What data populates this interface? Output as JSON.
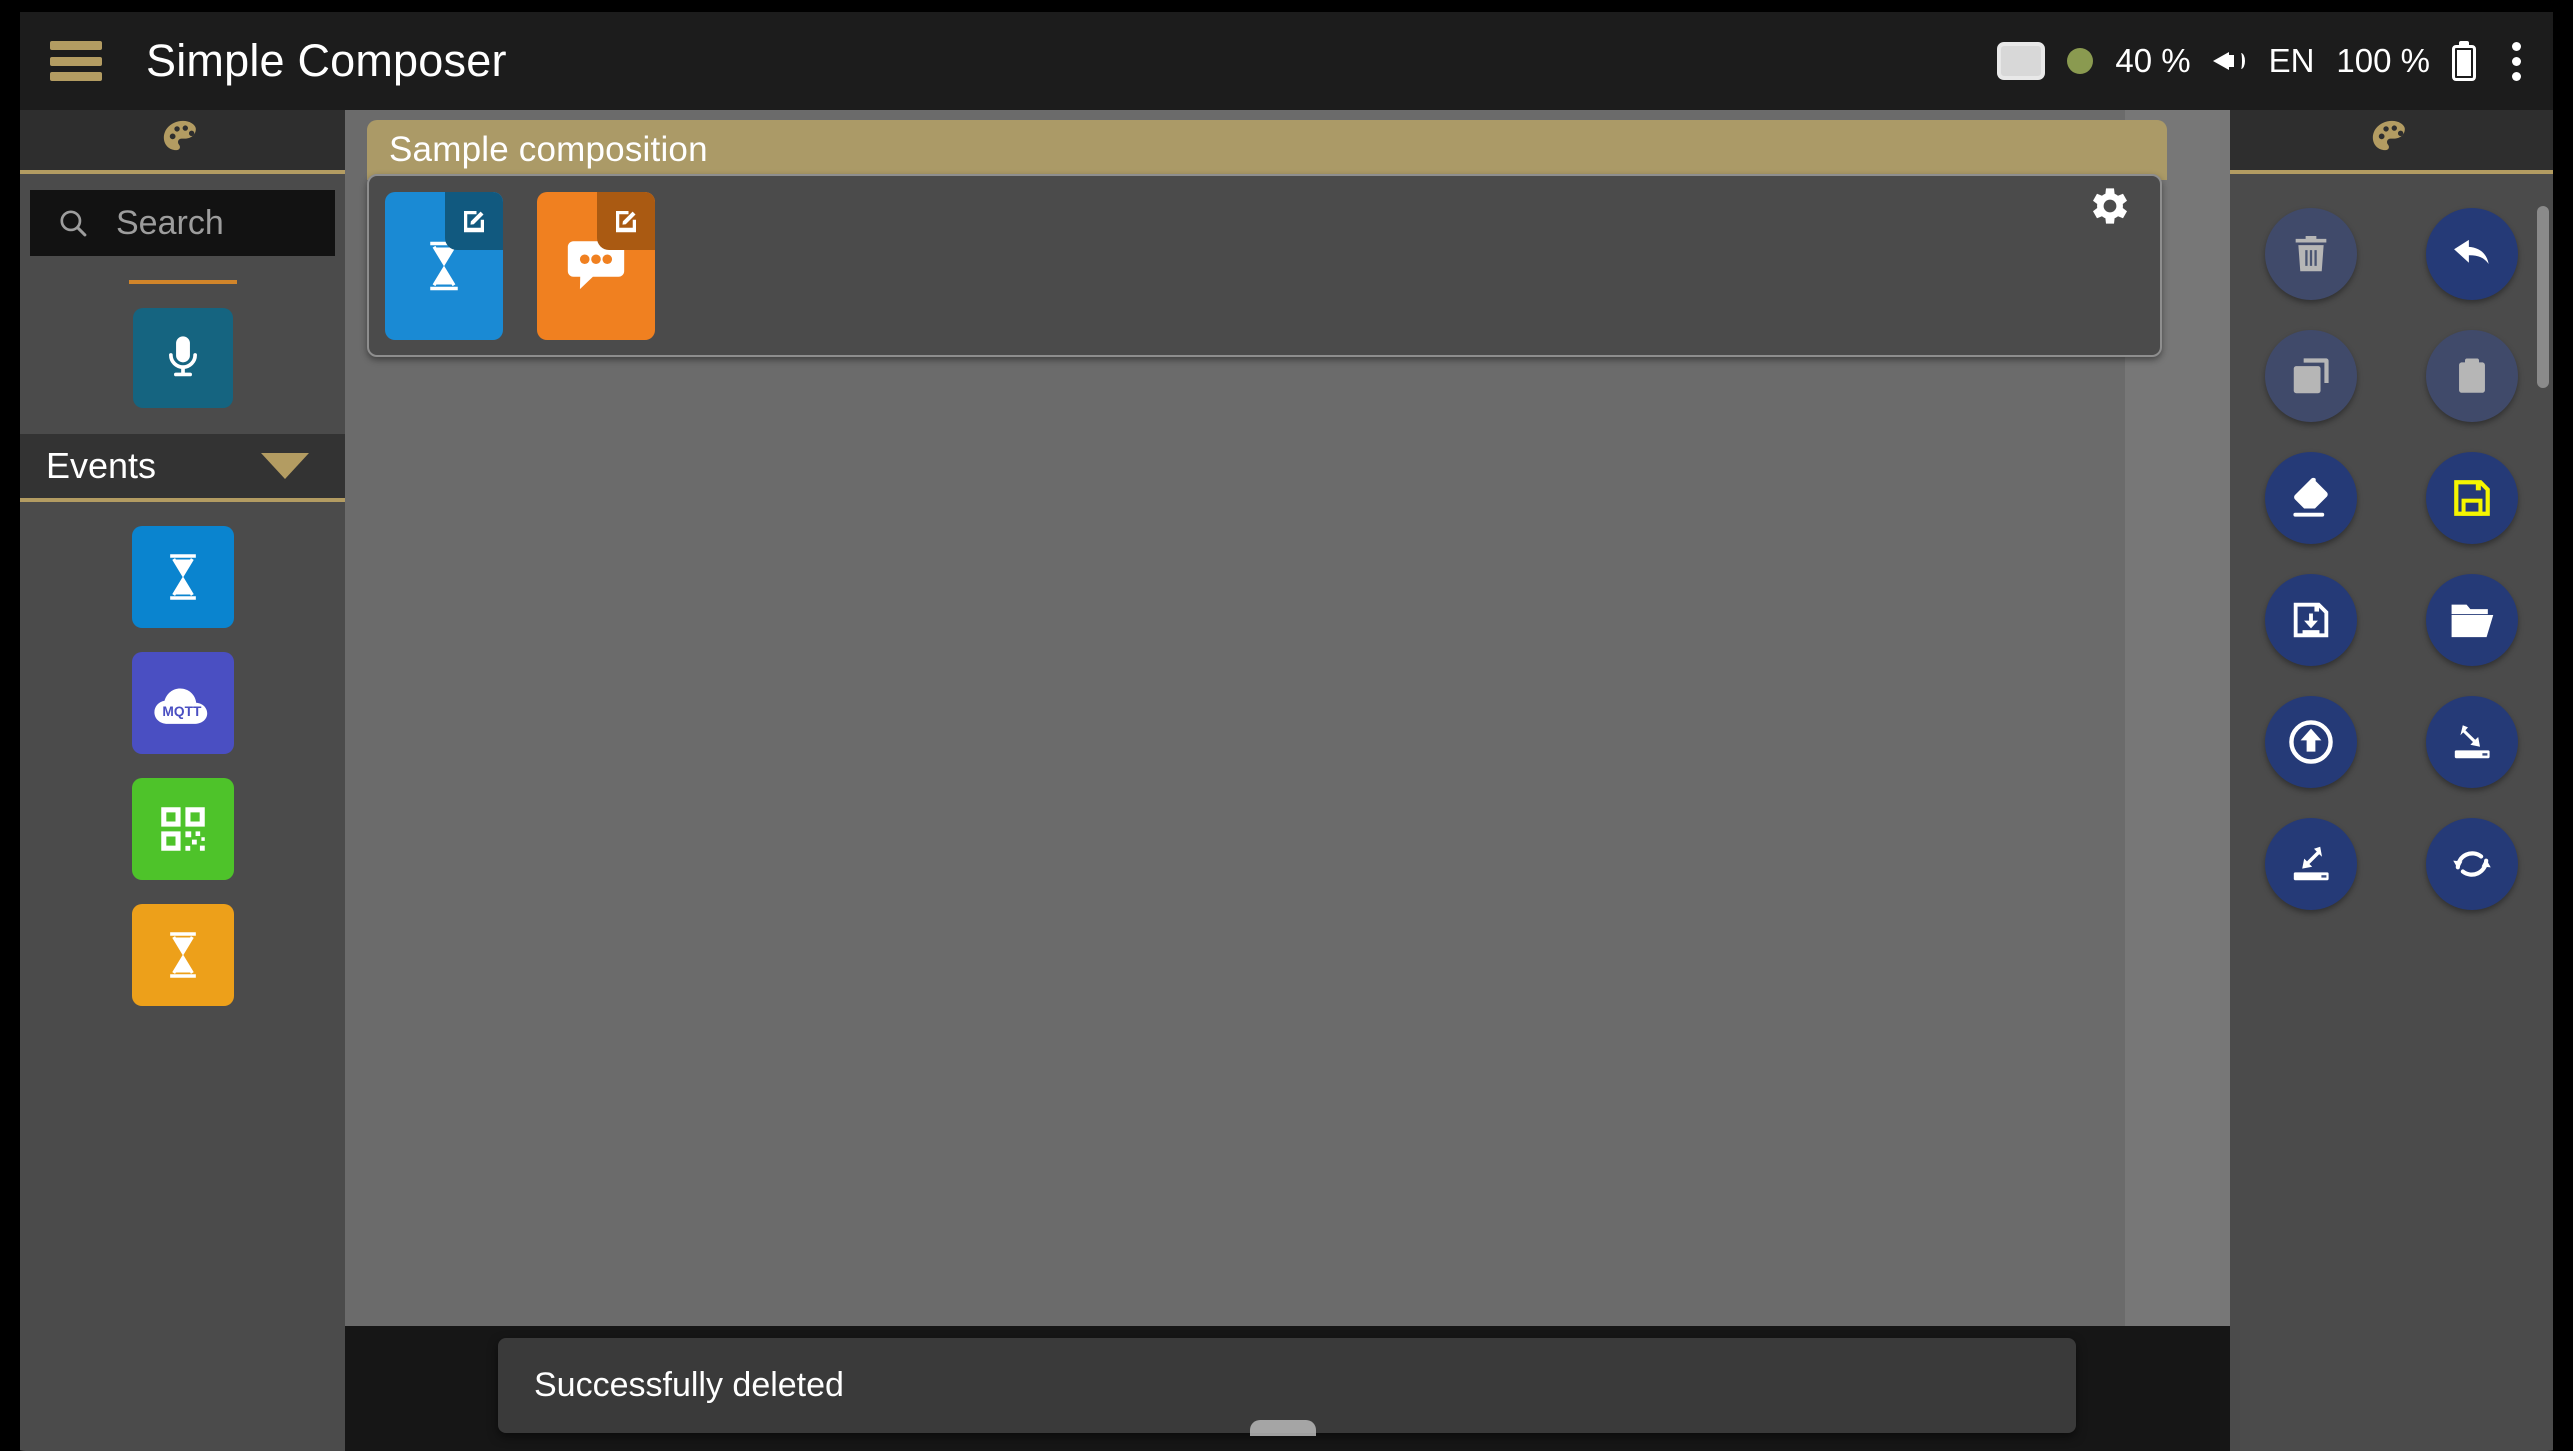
{
  "app": {
    "title": "Simple Composer",
    "menu_icon": "hamburger-icon",
    "overflow_icon": "three-dot-menu-icon"
  },
  "statusbar": {
    "screen_icon": "screen-icon",
    "recording_dot": "green-status-dot",
    "brightness": "40 %",
    "volume_icon": "speaker-icon",
    "language": "EN",
    "battery_level": "100 %",
    "battery_icon": "battery-icon"
  },
  "left_panel": {
    "header_icon": "palette-icon",
    "search": {
      "icon": "search-icon",
      "value": "",
      "placeholder": "Search"
    },
    "featured": {
      "name": "microphone-tile",
      "icon": "microphone-icon",
      "color": "#156480"
    },
    "section": {
      "label": "Events",
      "caret_icon": "chevron-down-icon",
      "expanded": true
    },
    "items": [
      {
        "name": "timer-tile",
        "icon": "hourglass-icon",
        "color": "#0a84cf"
      },
      {
        "name": "mqtt-tile",
        "icon": "mqtt-cloud-icon",
        "color": "#4a4fc2"
      },
      {
        "name": "qrcode-tile",
        "icon": "qr-code-icon",
        "color": "#4ec32a"
      },
      {
        "name": "timeout-tile",
        "icon": "hourglass-icon",
        "color": "#eda01a"
      }
    ]
  },
  "composition": {
    "title": "Sample composition",
    "settings_icon": "gear-icon",
    "blocks": [
      {
        "name": "timer-block",
        "icon": "hourglass-icon",
        "color": "#1a8ad4",
        "badge_icon": "edit-pencil-icon",
        "badge_color": "#11597f"
      },
      {
        "name": "message-block",
        "icon": "chat-bubble-icon",
        "color": "#f08020",
        "badge_icon": "edit-pencil-icon",
        "badge_color": "#aa5a12"
      }
    ]
  },
  "right_panel": {
    "header_icon": "palette-icon",
    "tools": [
      {
        "name": "delete-button",
        "icon": "trash-icon",
        "state": "disabled",
        "icon_color": "#b6b6b6"
      },
      {
        "name": "undo-button",
        "icon": "undo-arrow-icon",
        "state": "active",
        "icon_color": "#ffffff"
      },
      {
        "name": "copy-button",
        "icon": "copy-icon",
        "state": "disabled",
        "icon_color": "#b6b6b6"
      },
      {
        "name": "paste-button",
        "icon": "clipboard-icon",
        "state": "disabled",
        "icon_color": "#b6b6b6"
      },
      {
        "name": "clear-button",
        "icon": "eraser-icon",
        "state": "active",
        "icon_color": "#ffffff"
      },
      {
        "name": "save-button",
        "icon": "floppy-disk-icon",
        "state": "active",
        "icon_color": "#f5f500"
      },
      {
        "name": "save-as-button",
        "icon": "floppy-download-icon",
        "state": "active",
        "icon_color": "#ffffff"
      },
      {
        "name": "open-button",
        "icon": "folder-open-icon",
        "state": "active",
        "icon_color": "#ffffff"
      },
      {
        "name": "upload-button",
        "icon": "upload-circle-icon",
        "state": "active",
        "icon_color": "#ffffff"
      },
      {
        "name": "import-button",
        "icon": "import-to-device-icon",
        "state": "active",
        "icon_color": "#ffffff"
      },
      {
        "name": "export-button",
        "icon": "export-from-device-icon",
        "state": "active",
        "icon_color": "#ffffff"
      },
      {
        "name": "sync-button",
        "icon": "sync-refresh-icon",
        "state": "active",
        "icon_color": "#ffffff"
      }
    ]
  },
  "snackbar": {
    "message": "Successfully deleted"
  },
  "colors": {
    "accent_tan": "#b39c62",
    "panel_bg": "#4b4b4b",
    "canvas_bg": "#6b6b6b",
    "appbar_bg": "#1c1c1c",
    "button_active": "#253a77",
    "button_disabled": "#404a6a"
  }
}
